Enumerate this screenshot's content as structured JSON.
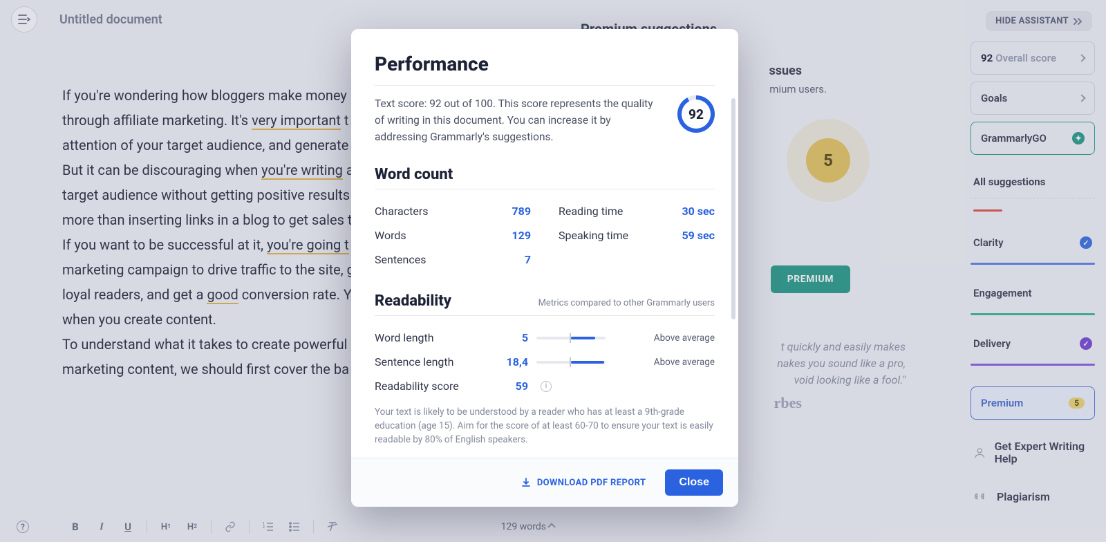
{
  "header": {
    "doc_title": "Untitled document",
    "hide_assistant": "HIDE ASSISTANT"
  },
  "editor": {
    "text_segments": [
      {
        "t": "If you're wondering how bloggers make money "
      },
      {
        "t": "through affiliate marketing. It's "
      },
      {
        "t": "very important",
        "u": true
      },
      {
        "t": " t"
      },
      {
        "t": "attention of your target audience, and generate"
      },
      {
        "t": "But it can be discouraging when "
      },
      {
        "t": "you're writing",
        "u": true
      },
      {
        "t": " a"
      },
      {
        "t": "target audience without getting positive results"
      },
      {
        "t": "more than inserting links in a blog to get sales t"
      },
      {
        "t": "If you want to be successful at it, "
      },
      {
        "t": "you're going t",
        "u": true
      },
      {
        "t": "marketing campaign to drive traffic to the site, g"
      },
      {
        "t": "loyal readers, and get a "
      },
      {
        "t": "good",
        "u": true
      },
      {
        "t": " conversion rate. Y"
      },
      {
        "t": "when you create content."
      },
      {
        "t": "To understand what it takes to create powerful "
      },
      {
        "t": "marketing content, we should first cover the ba"
      }
    ]
  },
  "premium_peek": {
    "suggestions_title": "Premium suggestions",
    "issues": "ssues",
    "subtitle_fragment": "mium users.",
    "count": "5",
    "go_premium": "PREMIUM",
    "quote_l1": "t quickly and easily makes",
    "quote_l2": "nakes you sound like a pro,",
    "quote_l3": "void looking like a fool.\"",
    "forbes": "rbes"
  },
  "right_panel": {
    "score_num": "92",
    "score_label": "Overall score",
    "goals": "Goals",
    "grammarlygo": "GrammarlyGO",
    "all_sugg": "All suggestions",
    "clarity": "Clarity",
    "engagement": "Engagement",
    "delivery": "Delivery",
    "premium": "Premium",
    "premium_count": "5",
    "help": "Get Expert Writing Help",
    "plagiarism": "Plagiarism"
  },
  "bottom": {
    "words": "129 words"
  },
  "modal": {
    "perf_title": "Performance",
    "perf_desc": "Text score: 92 out of 100. This score represents the quality of writing in this document. You can increase it by addressing Grammarly's suggestions.",
    "score": "92",
    "wc_title": "Word count",
    "characters_label": "Characters",
    "characters": "789",
    "words_label": "Words",
    "words": "129",
    "sentences_label": "Sentences",
    "sentences": "7",
    "reading_label": "Reading time",
    "reading": "30 sec",
    "speaking_label": "Speaking time",
    "speaking": "59 sec",
    "read_title": "Readability",
    "read_sub": "Metrics compared to other Grammarly users",
    "wordlen_label": "Word length",
    "wordlen": "5",
    "wordlen_cmp": "Above average",
    "sentlen_label": "Sentence length",
    "sentlen": "18,4",
    "sentlen_cmp": "Above average",
    "readscore_label": "Readability score",
    "readscore": "59",
    "read_desc": "Your text is likely to be understood by a reader who has at least a 9th-grade education (age 15). Aim for the score of at least 60-70 to ensure your text is easily readable by 80% of English speakers.",
    "download": "DOWNLOAD PDF REPORT",
    "close": "Close"
  }
}
